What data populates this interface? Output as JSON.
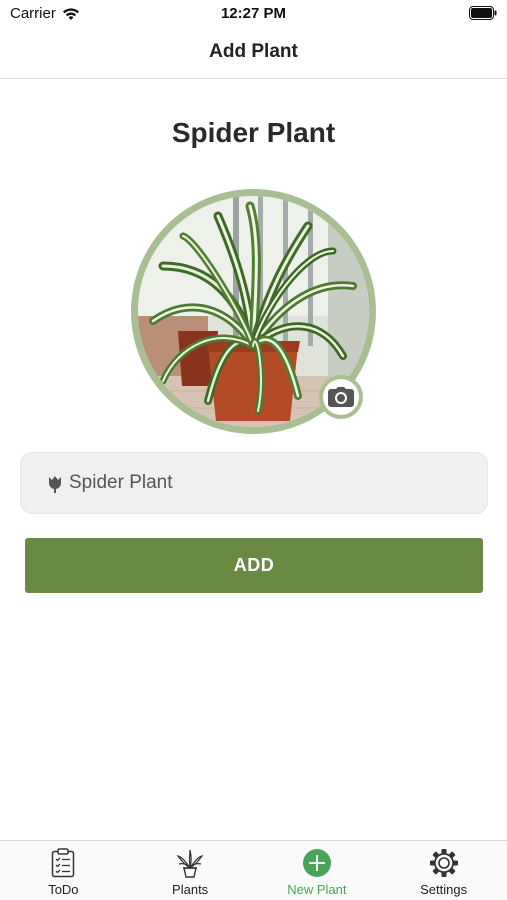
{
  "status_bar": {
    "carrier": "Carrier",
    "time": "12:27 PM",
    "wifi_icon": "wifi-icon",
    "battery_icon": "battery-icon"
  },
  "nav": {
    "title": "Add Plant"
  },
  "main": {
    "plant_name_title": "Spider Plant",
    "photo": {
      "description_icon": "spider-plant-photo",
      "camera_icon": "camera-icon"
    },
    "name_field": {
      "icon": "tulip-icon",
      "value": "Spider Plant",
      "placeholder": ""
    },
    "add_button_label": "ADD"
  },
  "tab_bar": {
    "tabs": [
      {
        "label": "ToDo",
        "icon": "clipboard-checklist-icon",
        "active": false
      },
      {
        "label": "Plants",
        "icon": "potted-plant-icon",
        "active": false
      },
      {
        "label": "New Plant",
        "icon": "add-circle-icon",
        "active": true
      },
      {
        "label": "Settings",
        "icon": "gear-icon",
        "active": false
      }
    ]
  },
  "colors": {
    "accent_green": "#6a8a44",
    "ring_green": "#a9bf93",
    "active_tab": "#4aa35a",
    "field_bg": "#f0f0f0"
  }
}
